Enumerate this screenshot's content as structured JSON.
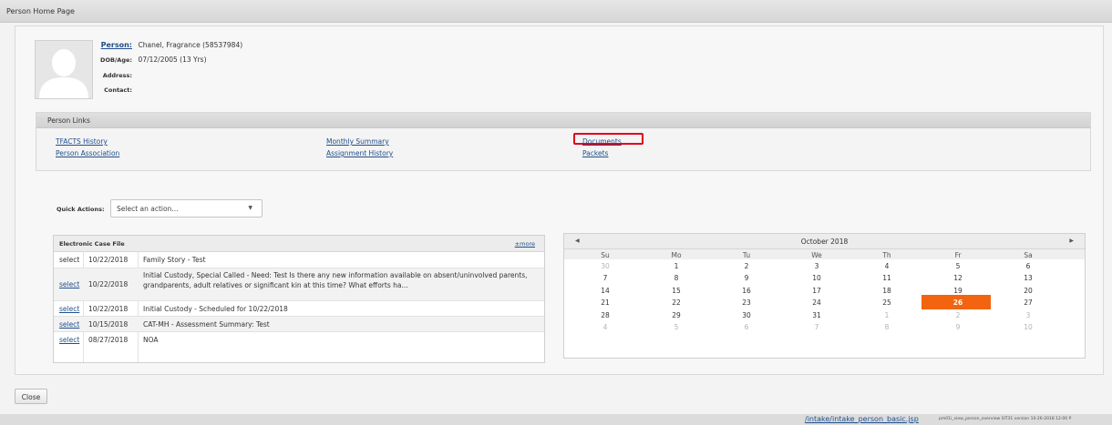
{
  "window_title": "Person Home Page",
  "person": {
    "label_person": "Person:",
    "name": "Chanel, Fragrance (58537984)",
    "label_dob": "DOB/Age:",
    "dob": "07/12/2005 (13 Yrs)",
    "label_address": "Address:",
    "address": "",
    "label_contact": "Contact:",
    "contact": ""
  },
  "person_links": {
    "title": "Person Links",
    "links": [
      {
        "label": "TFACTS History"
      },
      {
        "label": "Person Association"
      },
      {
        "label": "Monthly Summary"
      },
      {
        "label": "Assignment History"
      },
      {
        "label": "Documents"
      },
      {
        "label": "Packets"
      }
    ]
  },
  "quick_actions": {
    "label": "Quick Actions:",
    "placeholder": "Select an action..."
  },
  "ecf": {
    "title": "Electronic Case File",
    "more_label": "±more",
    "rows": [
      {
        "select": "select",
        "date": "10/22/2018",
        "desc": "Family Story - Test"
      },
      {
        "select": "select",
        "date": "10/22/2018",
        "desc": "Initial Custody, Special Called - Need: Test Is there any new information available on absent/uninvolved parents, grandparents, adult relatives or significant kin at this time? What efforts ha..."
      },
      {
        "select": "select",
        "date": "10/22/2018",
        "desc": "Initial Custody - Scheduled for 10/22/2018"
      },
      {
        "select": "select",
        "date": "10/15/2018",
        "desc": "CAT-MH - Assessment Summary: Test"
      },
      {
        "select": "select",
        "date": "08/27/2018",
        "desc": "NOA"
      }
    ]
  },
  "calendar": {
    "month_label": "October 2018",
    "prev_label": "◀",
    "next_label": "▶",
    "weekdays": [
      "Su",
      "Mo",
      "Tu",
      "We",
      "Th",
      "Fr",
      "Sa"
    ],
    "weeks": [
      [
        "30",
        "1",
        "2",
        "3",
        "4",
        "5",
        "6"
      ],
      [
        "7",
        "8",
        "9",
        "10",
        "11",
        "12",
        "13"
      ],
      [
        "14",
        "15",
        "16",
        "17",
        "18",
        "19",
        "20"
      ],
      [
        "21",
        "22",
        "23",
        "24",
        "25",
        "26",
        "27"
      ],
      [
        "28",
        "29",
        "30",
        "31",
        "1",
        "2",
        "3"
      ],
      [
        "4",
        "5",
        "6",
        "7",
        "8",
        "9",
        "10"
      ]
    ],
    "selected_day": "26",
    "selected_color": "#f2640f"
  },
  "close_label": "Close",
  "footer": {
    "path": "/intake/intake_person_basic.jsp",
    "info": "pm01i_view_person_overview  SIT31 version  10-26-2018 12:00 P"
  }
}
